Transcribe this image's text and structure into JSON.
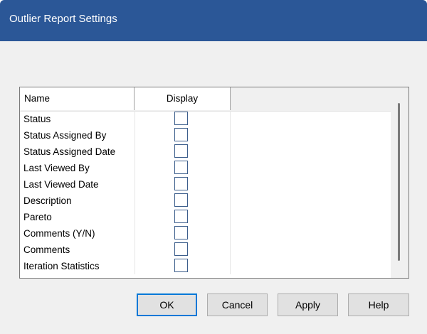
{
  "window": {
    "title": "Outlier Report Settings"
  },
  "grid": {
    "columns": [
      "Name",
      "Display"
    ],
    "rows": [
      {
        "name": "Status",
        "display": false
      },
      {
        "name": "Status Assigned By",
        "display": false
      },
      {
        "name": "Status Assigned Date",
        "display": false
      },
      {
        "name": "Last Viewed By",
        "display": false
      },
      {
        "name": "Last Viewed Date",
        "display": false
      },
      {
        "name": "Description",
        "display": false
      },
      {
        "name": "Pareto",
        "display": false
      },
      {
        "name": "Comments (Y/N)",
        "display": false
      },
      {
        "name": "Comments",
        "display": false
      },
      {
        "name": "Iteration Statistics",
        "display": false
      }
    ]
  },
  "buttons": {
    "ok": "OK",
    "cancel": "Cancel",
    "apply": "Apply",
    "help": "Help"
  },
  "colors": {
    "titlebar": "#2b5797",
    "checkbox_border": "#3c5e8c",
    "default_button_border": "#0078d7"
  }
}
